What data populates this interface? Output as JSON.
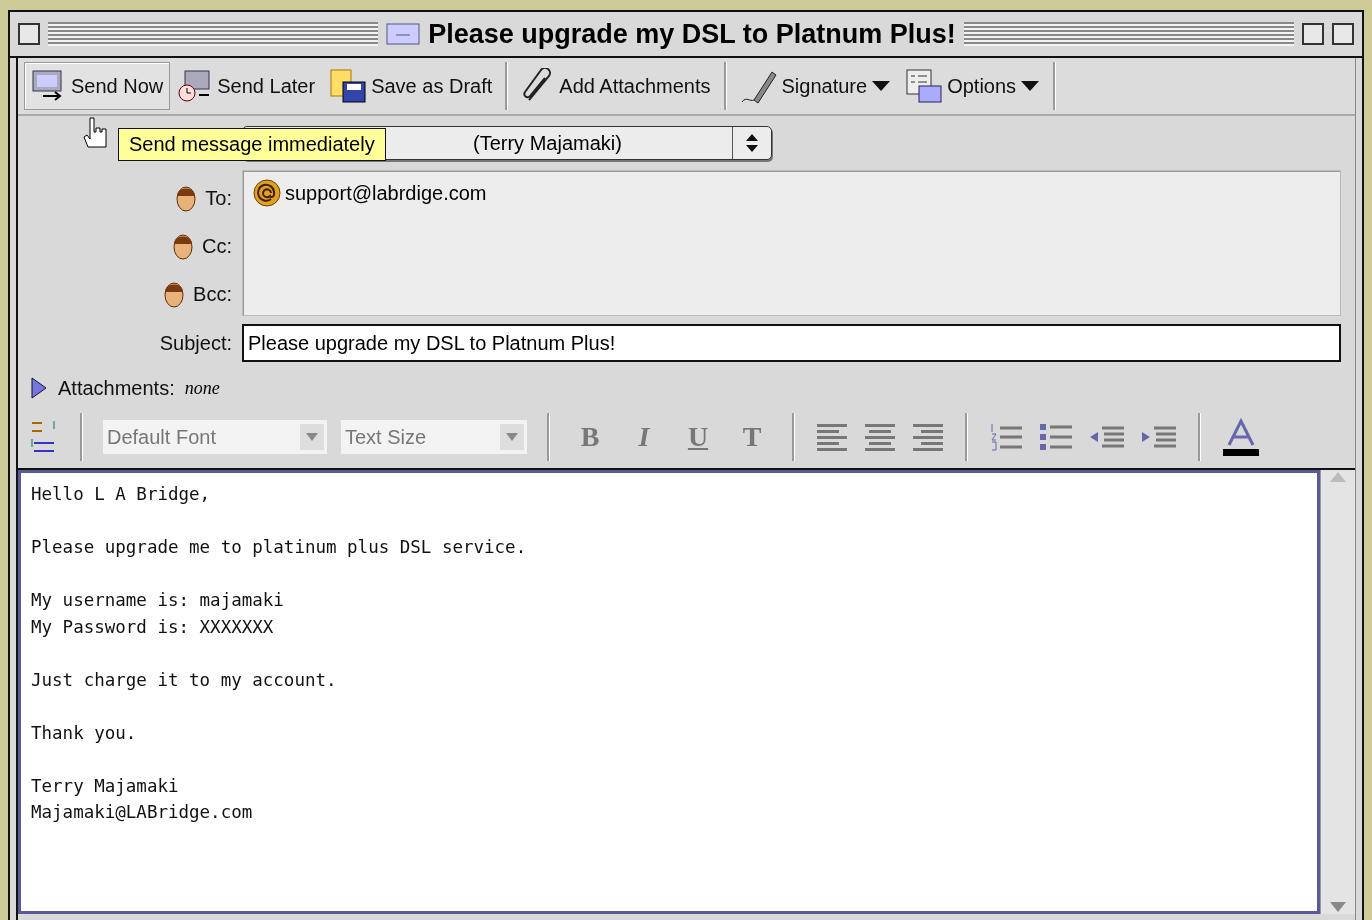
{
  "window": {
    "title": "Please upgrade my DSL to Platnum Plus!"
  },
  "toolbar": [
    {
      "label": "Send Now",
      "selected": true,
      "menu": false
    },
    {
      "label": "Send Later",
      "selected": false,
      "menu": false
    },
    {
      "label": "Save as Draft",
      "selected": false,
      "menu": false
    },
    {
      "label": "Add Attachments",
      "selected": false,
      "menu": false
    },
    {
      "label": "Signature",
      "selected": false,
      "menu": true
    },
    {
      "label": "Options",
      "selected": false,
      "menu": true
    }
  ],
  "tooltip": "Send message immediately",
  "from": {
    "value": "(Terry Majamaki)"
  },
  "recipients": {
    "labels": [
      "To:",
      "Cc:",
      "Bcc:"
    ],
    "addresses": [
      "support@labrdige.com"
    ]
  },
  "subject": {
    "label": "Subject:",
    "value": "Please upgrade my DSL to Platnum Plus!"
  },
  "attachments": {
    "label": "Attachments:",
    "value": "none",
    "expanded": false
  },
  "format": {
    "font": "Default Font",
    "size": "Text Size",
    "styles": [
      {
        "kind": "bold",
        "glyph": "B"
      },
      {
        "kind": "italic",
        "glyph": "I"
      },
      {
        "kind": "underline",
        "glyph": "U"
      },
      {
        "kind": "teletype",
        "glyph": "T"
      }
    ]
  },
  "body": [
    [
      "Hello L A Bridge,"
    ],
    [
      "Please upgrade me to platinum plus DSL service."
    ],
    [
      "My username is: majamaki",
      "My Password is: XXXXXXX"
    ],
    [
      "Just charge it to my account."
    ],
    [
      "Thank you."
    ],
    [
      "Terry Majamaki",
      "Majamaki@LABridge.com"
    ]
  ]
}
